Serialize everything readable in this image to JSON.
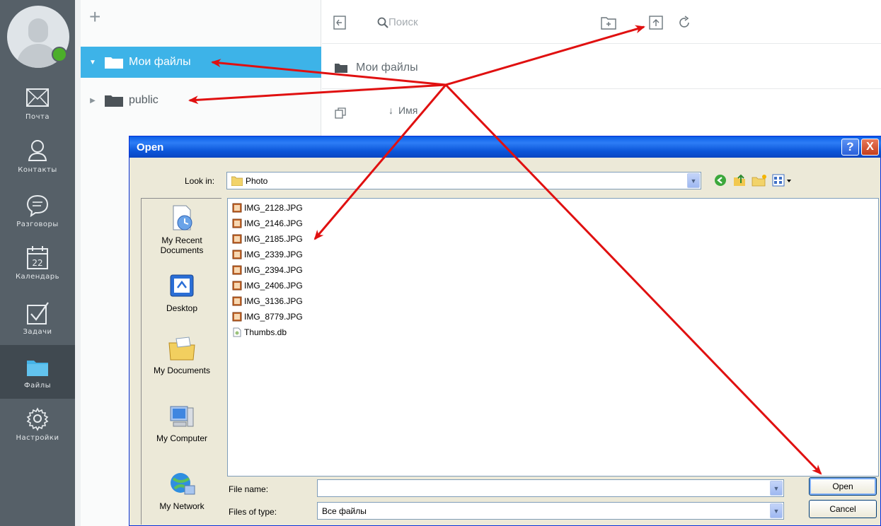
{
  "sidebar": {
    "items": [
      {
        "label": "Почта",
        "icon": "mail-icon"
      },
      {
        "label": "Контакты",
        "icon": "contacts-icon"
      },
      {
        "label": "Разговоры",
        "icon": "chat-icon"
      },
      {
        "label": "Календарь",
        "icon": "calendar-icon",
        "day": "22"
      },
      {
        "label": "Задачи",
        "icon": "tasks-icon"
      },
      {
        "label": "Файлы",
        "icon": "folder-icon"
      },
      {
        "label": "Настройки",
        "icon": "gear-icon"
      }
    ]
  },
  "tree": {
    "add_label": "+",
    "items": [
      {
        "label": "Мои файлы"
      },
      {
        "label": "public"
      }
    ]
  },
  "files": {
    "search_placeholder": "Поиск",
    "breadcrumb": "Мои файлы",
    "sort_label": "Имя"
  },
  "dialog": {
    "title": "Open",
    "help": "?",
    "close": "X",
    "look_in_label": "Look in:",
    "look_in_value": "Photo",
    "places": [
      "My Recent Documents",
      "Desktop",
      "My Documents",
      "My Computer",
      "My Network"
    ],
    "files": [
      "IMG_2128.JPG",
      "IMG_2146.JPG",
      "IMG_2185.JPG",
      "IMG_2339.JPG",
      "IMG_2394.JPG",
      "IMG_2406.JPG",
      "IMG_3136.JPG",
      "IMG_8779.JPG",
      "Thumbs.db"
    ],
    "file_name_label": "File name:",
    "file_name_value": "",
    "file_type_label": "Files of type:",
    "file_type_value": "Все файлы",
    "open_button": "Open",
    "cancel_button": "Cancel"
  },
  "colors": {
    "sidebar": "#566068",
    "selected": "#3db3e8",
    "annotation": "#e01010",
    "xp_title": "#0a5ee6"
  }
}
